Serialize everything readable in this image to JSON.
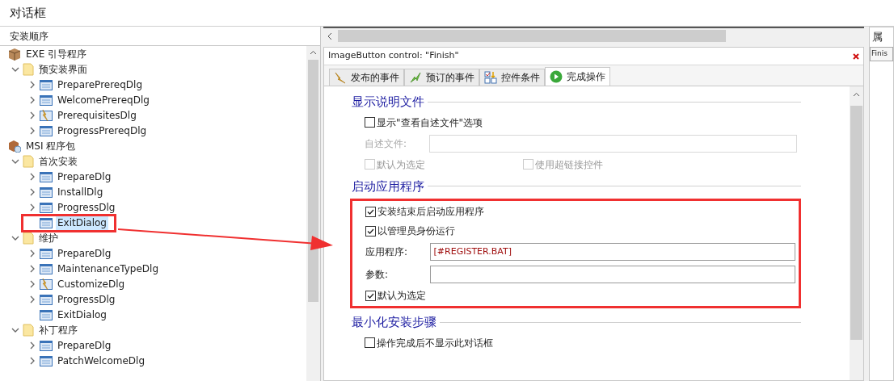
{
  "window": {
    "title": "对话框"
  },
  "sidebar": {
    "title": "安装顺序",
    "tree": [
      {
        "label": "EXE 引导程序",
        "kind": "exe",
        "children": [
          {
            "label": "预安装界面",
            "kind": "folder",
            "expanded": true,
            "children": [
              {
                "label": "PreparePrereqDlg",
                "kind": "dialog",
                "expandable": true,
                "selected": false
              },
              {
                "label": "WelcomePrereqDlg",
                "kind": "dialog",
                "expandable": true,
                "selected": false
              },
              {
                "label": "PrerequisitesDlg",
                "kind": "custom",
                "expandable": true,
                "selected": false
              },
              {
                "label": "ProgressPrereqDlg",
                "kind": "dialog",
                "expandable": true,
                "selected": false
              }
            ]
          }
        ]
      },
      {
        "label": "MSI 程序包",
        "kind": "msi",
        "children": [
          {
            "label": "首次安装",
            "kind": "folder",
            "expanded": true,
            "children": [
              {
                "label": "PrepareDlg",
                "kind": "dialog",
                "expandable": true,
                "selected": false
              },
              {
                "label": "InstallDlg",
                "kind": "dialog",
                "expandable": true,
                "selected": false
              },
              {
                "label": "ProgressDlg",
                "kind": "dialog",
                "expandable": true,
                "selected": false
              },
              {
                "label": "ExitDialog",
                "kind": "dialog",
                "expandable": false,
                "selected": true
              }
            ]
          },
          {
            "label": "维护",
            "kind": "folder",
            "expanded": true,
            "children": [
              {
                "label": "PrepareDlg",
                "kind": "dialog",
                "expandable": true,
                "selected": false
              },
              {
                "label": "MaintenanceTypeDlg",
                "kind": "dialog",
                "expandable": true,
                "selected": false
              },
              {
                "label": "CustomizeDlg",
                "kind": "custom",
                "expandable": true,
                "selected": false
              },
              {
                "label": "ProgressDlg",
                "kind": "dialog",
                "expandable": true,
                "selected": false
              },
              {
                "label": "ExitDialog",
                "kind": "dialog",
                "expandable": false,
                "selected": false
              }
            ]
          },
          {
            "label": "补丁程序",
            "kind": "folder",
            "expanded": true,
            "children": [
              {
                "label": "PrepareDlg",
                "kind": "dialog",
                "expandable": true,
                "selected": false
              },
              {
                "label": "PatchWelcomeDlg",
                "kind": "dialog",
                "expandable": true,
                "selected": false
              }
            ]
          }
        ]
      }
    ]
  },
  "editor": {
    "title": "ImageButton control: \"Finish\"",
    "tabs": [
      {
        "label": "发布的事件",
        "kind": "publish",
        "selected": false
      },
      {
        "label": "预订的事件",
        "kind": "subscribe",
        "selected": false
      },
      {
        "label": "控件条件",
        "kind": "condition",
        "selected": false
      },
      {
        "label": "完成操作",
        "kind": "finish",
        "selected": true
      }
    ],
    "sections": [
      {
        "title": "显示说明文件",
        "highlighted": false,
        "rows": [
          {
            "kind": "checkbox",
            "label": "显示\"查看自述文件\"选项",
            "checked": false,
            "disabled": false
          },
          {
            "kind": "field",
            "label": "自述文件:",
            "value": "",
            "disabled": true
          },
          {
            "kind": "checkbox_pair",
            "items": [
              {
                "label": "默认为选定",
                "checked": false,
                "disabled": true
              },
              {
                "label": "使用超链接控件",
                "checked": false,
                "disabled": true
              }
            ]
          }
        ]
      },
      {
        "title": "启动应用程序",
        "highlighted": true,
        "rows": [
          {
            "kind": "checkbox",
            "label": "安装结束后启动应用程序",
            "checked": true,
            "disabled": false
          },
          {
            "kind": "checkbox",
            "label": "以管理员身份运行",
            "checked": true,
            "disabled": false
          },
          {
            "kind": "field",
            "label": "应用程序:",
            "value": "[#REGISTER.BAT]",
            "disabled": false
          },
          {
            "kind": "field",
            "label": "参数:",
            "value": "",
            "disabled": false
          },
          {
            "kind": "checkbox",
            "label": "默认为选定",
            "checked": true,
            "disabled": false
          }
        ]
      },
      {
        "title": "最小化安装步骤",
        "highlighted": false,
        "rows": [
          {
            "kind": "checkbox",
            "label": "操作完成后不显示此对话框",
            "checked": false,
            "disabled": false
          }
        ]
      }
    ]
  },
  "properties": {
    "title": "属",
    "selector": "Finis"
  }
}
